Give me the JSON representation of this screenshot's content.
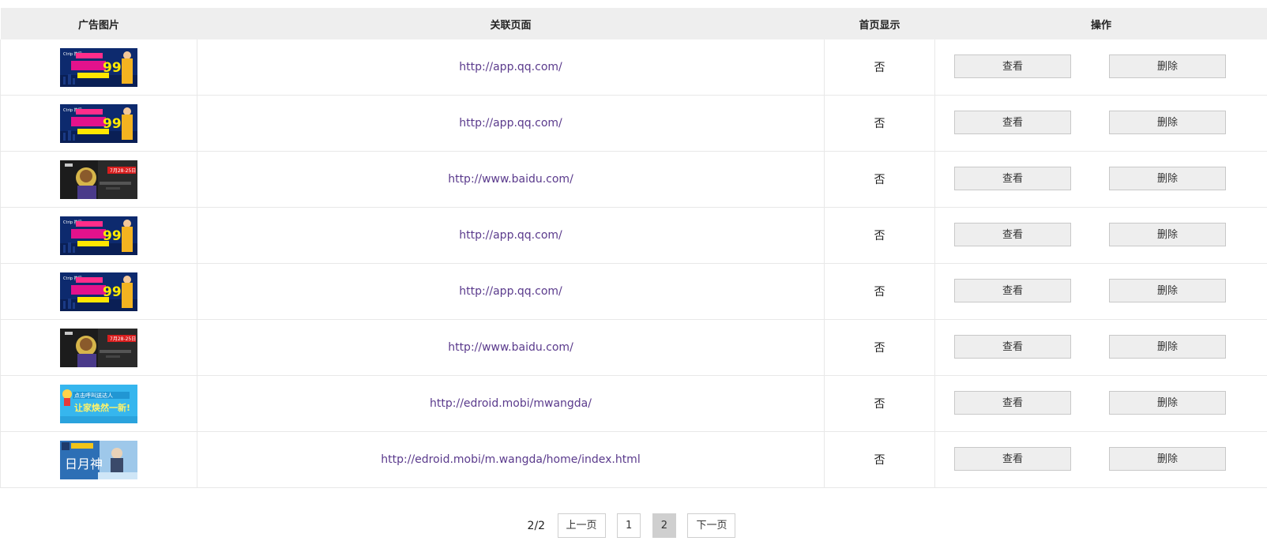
{
  "columns": {
    "image": "广告图片",
    "url": "关联页面",
    "home": "首页显示",
    "ops": "操作"
  },
  "rows": [
    {
      "banner": "ctrip-promo",
      "url": "http://app.qq.com/",
      "home": "否",
      "view": "查看",
      "delete": "删除"
    },
    {
      "banner": "ctrip-promo",
      "url": "http://app.qq.com/",
      "home": "否",
      "view": "查看",
      "delete": "删除"
    },
    {
      "banner": "game-hero",
      "url": "http://www.baidu.com/",
      "home": "否",
      "view": "查看",
      "delete": "删除"
    },
    {
      "banner": "ctrip-promo",
      "url": "http://app.qq.com/",
      "home": "否",
      "view": "查看",
      "delete": "删除"
    },
    {
      "banner": "ctrip-promo",
      "url": "http://app.qq.com/",
      "home": "否",
      "view": "查看",
      "delete": "删除"
    },
    {
      "banner": "game-hero",
      "url": "http://www.baidu.com/",
      "home": "否",
      "view": "查看",
      "delete": "删除"
    },
    {
      "banner": "cartoon-lightblue",
      "url": "http://edroid.mobi/mwangda/",
      "home": "否",
      "view": "查看",
      "delete": "删除"
    },
    {
      "banner": "swordsman-game",
      "url": "http://edroid.mobi/m.wangda/home/index.html",
      "home": "否",
      "view": "查看",
      "delete": "删除"
    }
  ],
  "pager": {
    "total": "2/2",
    "prev": "上一页",
    "page1": "1",
    "page2": "2",
    "next": "下一页",
    "current": 2
  },
  "colors": {
    "header_bg": "#eeeeee",
    "link": "#5a3a8c",
    "button_bg": "#eeeeee",
    "active_page_bg": "#cfcfcf"
  }
}
